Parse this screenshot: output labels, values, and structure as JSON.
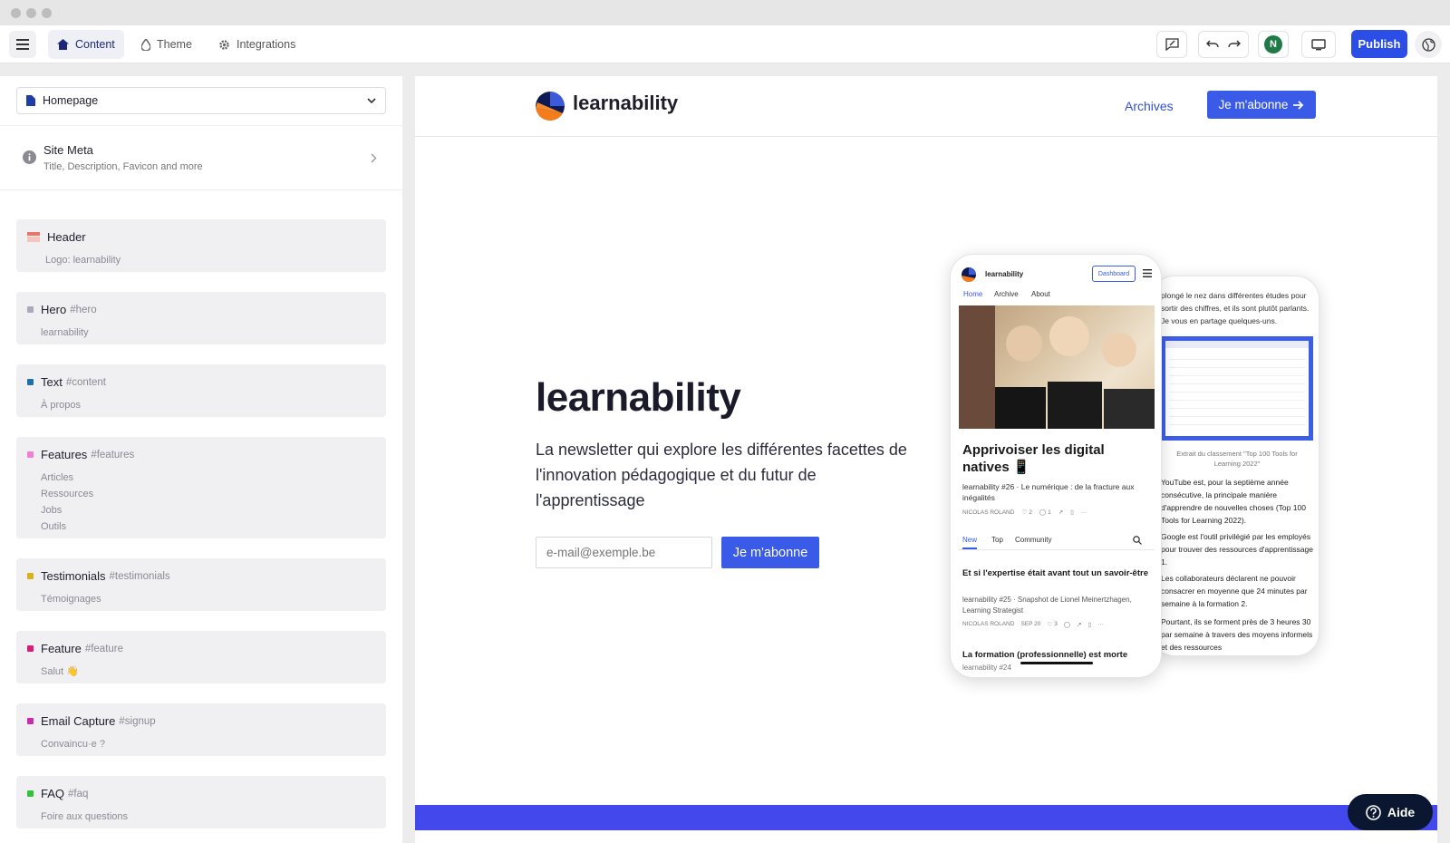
{
  "topbar": {
    "tabs": [
      {
        "label": "Content",
        "icon": "home-icon",
        "active": true
      },
      {
        "label": "Theme",
        "icon": "drop-icon"
      },
      {
        "label": "Integrations",
        "icon": "gear-icon"
      }
    ],
    "user_initial": "N",
    "publish_label": "Publish",
    "accent": "#2b4ee6"
  },
  "sidebar": {
    "page_select": {
      "value": "Homepage"
    },
    "site_meta": {
      "title": "Site Meta",
      "subtitle": "Title, Description, Favicon and more"
    },
    "sections": [
      {
        "title": "Header",
        "anchor": "",
        "items": [
          "Logo: learnability"
        ],
        "color": "#e8766a"
      },
      {
        "title": "Hero",
        "anchor": "#hero",
        "items": [
          "learnability"
        ],
        "color": "#a9a9be"
      },
      {
        "title": "Text",
        "anchor": "#content",
        "items": [
          "À propos"
        ],
        "color": "#1f6fa8"
      },
      {
        "title": "Features",
        "anchor": "#features",
        "items": [
          "Articles",
          "Ressources",
          "Jobs",
          "Outils"
        ],
        "color": "#f07fd6"
      },
      {
        "title": "Testimonials",
        "anchor": "#testimonials",
        "items": [
          "Témoignages"
        ],
        "color": "#d9b21a"
      },
      {
        "title": "Feature",
        "anchor": "#feature",
        "items": [
          "Salut 👋"
        ],
        "color": "#d61d79"
      },
      {
        "title": "Email Capture",
        "anchor": "#signup",
        "items": [
          "Convaincu·e ?"
        ],
        "color": "#c82bb0"
      },
      {
        "title": "FAQ",
        "anchor": "#faq",
        "items": [
          "Foire aux questions"
        ],
        "color": "#30c23a"
      }
    ]
  },
  "preview": {
    "brand": "learnability",
    "nav_archives": "Archives",
    "nav_subscribe": "Je m'abonne",
    "hero_title": "learnability",
    "hero_desc": "La newsletter qui explore les différentes facettes de l'innovation pédagogique et du futur de l'apprentissage",
    "email_placeholder": "e-mail@exemple.be",
    "hero_button": "Je m'abonne",
    "phone1": {
      "brand": "learnability",
      "dashboard": "Dashboard",
      "nav": [
        "Home",
        "Archive",
        "About"
      ],
      "post_title": "Apprivoiser les digital natives 📱",
      "post_sub": "learnability #26 · Le numérique : de la fracture aux inégalités",
      "post_meta": "NICOLAS ROLAND",
      "post_likes": "2",
      "post_comments": "1",
      "feed_tabs": [
        "New",
        "Top",
        "Community"
      ],
      "item1_title": "Et si l'expertise était avant tout un savoir-être",
      "item1_sub": "learnability #25 · Snapshot de Lionel Meinertzhagen, Learning Strategist",
      "item1_meta": "NICOLAS ROLAND",
      "item1_date": "SEP 20",
      "item1_likes": "3",
      "item2_title": "La formation (professionnelle) est morte",
      "item2_sub": "learnability #24"
    },
    "phone2": {
      "p1": "plongé le nez dans différentes études pour sortir des chiffres, et ils sont plutôt parlants. Je vous en partage quelques-uns.",
      "caption": "Extrait du classement \"Top 100 Tools for Learning 2022\"",
      "b1": "YouTube est, pour la septième année consécutive, la principale manière d'apprendre de nouvelles choses (Top 100 Tools for Learning 2022).",
      "b2": "Google est l'outil privilégié par les employés pour trouver des ressources d'apprentissage 1.",
      "b3": "Les collaborateurs déclarent ne pouvoir consacrer en moyenne que 24 minutes par semaine à la formation 2.",
      "b4": "Pourtant, ils se forment près de 3 heures 30 par semaine à travers des moyens informels et des ressources"
    }
  },
  "help": {
    "label": "Aide"
  }
}
